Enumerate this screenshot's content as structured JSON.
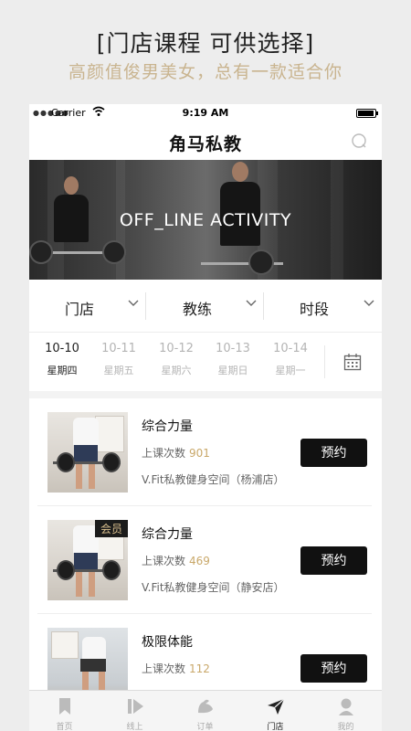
{
  "promo": {
    "title": "[门店课程 可供选择]",
    "subtitle": "高颜值俊男美女，总有一款适合你"
  },
  "status": {
    "carrier": "Carrier",
    "time": "9:19 AM"
  },
  "app": {
    "title": "角马私教"
  },
  "banner": {
    "text": "OFF_LINE ACTIVITY"
  },
  "filters": [
    {
      "label": "门店"
    },
    {
      "label": "教练"
    },
    {
      "label": "时段"
    }
  ],
  "dates": [
    {
      "date": "10-10",
      "weekday": "星期四",
      "active": true
    },
    {
      "date": "10-11",
      "weekday": "星期五",
      "active": false
    },
    {
      "date": "10-12",
      "weekday": "星期六",
      "active": false
    },
    {
      "date": "10-13",
      "weekday": "星期日",
      "active": false
    },
    {
      "date": "10-14",
      "weekday": "星期一",
      "active": false
    }
  ],
  "courses": [
    {
      "title": "综合力量",
      "count_label": "上课次数",
      "count": "901",
      "store": "V.Fit私教健身空间（杨浦店）",
      "badge": "",
      "button": "预约"
    },
    {
      "title": "综合力量",
      "count_label": "上课次数",
      "count": "469",
      "store": "V.Fit私教健身空间（静安店）",
      "badge": "会员",
      "button": "预约"
    },
    {
      "title": "极限体能",
      "count_label": "上课次数",
      "count": "112",
      "store": "",
      "badge": "",
      "button": "预约"
    }
  ],
  "tabs": [
    {
      "label": "首页",
      "icon": "bookmark-icon",
      "active": false
    },
    {
      "label": "线上",
      "icon": "play-icon",
      "active": false
    },
    {
      "label": "订单",
      "icon": "muscle-icon",
      "active": false
    },
    {
      "label": "门店",
      "icon": "paper-plane-icon",
      "active": true
    },
    {
      "label": "我的",
      "icon": "user-icon",
      "active": false
    }
  ],
  "colors": {
    "accent_gold": "#c9a86a",
    "subtitle_gold": "#c9b48f",
    "button_black": "#111111"
  }
}
